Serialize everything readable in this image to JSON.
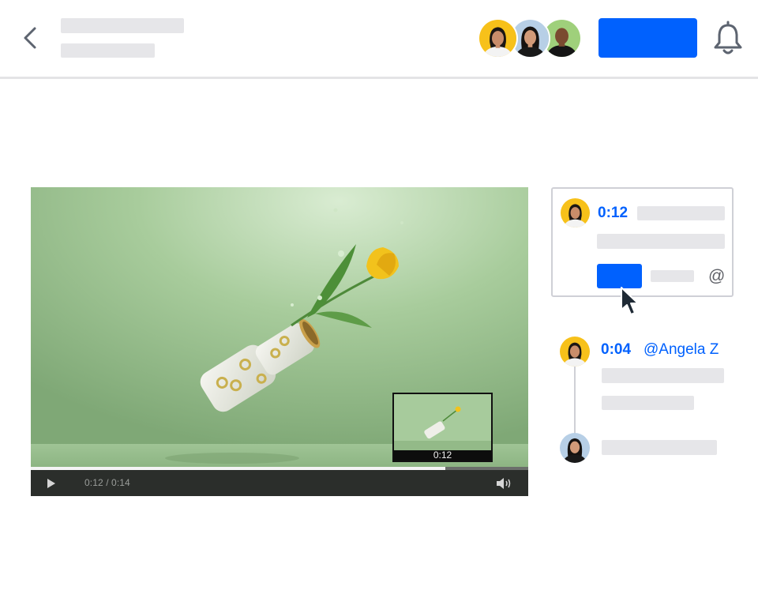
{
  "header": {
    "back_icon": "chevron-left-icon",
    "bell_icon": "bell-icon",
    "collaborators": [
      "collaborator-avatar-1",
      "collaborator-avatar-2",
      "collaborator-avatar-3"
    ]
  },
  "video": {
    "time_readout": "0:12 / 0:14",
    "progress": 0.833,
    "preview_time": "0:12",
    "play_icon": "play-icon",
    "volume_icon": "volume-icon"
  },
  "comment_card": {
    "timestamp": "0:12",
    "mention_symbol": "@"
  },
  "thread": {
    "timestamp": "0:04",
    "mention": "@Angela Z"
  },
  "colors": {
    "accent": "#0061fe",
    "placeholder": "#e6e6e9",
    "divider": "#e4e4e6"
  }
}
